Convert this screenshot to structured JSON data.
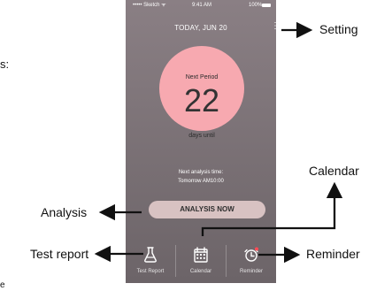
{
  "page_cutoff_text": {
    "left_top": "s:",
    "left_bottom": "e"
  },
  "status_bar": {
    "carrier": "••••• Sketch ᯤ",
    "time": "9:41 AM",
    "battery": "100%"
  },
  "header": {
    "title": "TODAY, JUN 20",
    "more_icon": "more-vertical-icon"
  },
  "period_card": {
    "label": "Next Period",
    "days": "22",
    "suffix": "days until"
  },
  "analysis_time": {
    "label": "Next analysis time:",
    "value": "Tomorrow AM10:00"
  },
  "analysis_button": {
    "label": "ANALYSIS NOW"
  },
  "bottom_nav": [
    {
      "label": "Test Report",
      "icon": "flask-icon"
    },
    {
      "label": "Calendar",
      "icon": "calendar-icon"
    },
    {
      "label": "Reminder",
      "icon": "alarm-clock-icon"
    }
  ],
  "annotations": {
    "setting": "Setting",
    "analysis": "Analysis",
    "test_report": "Test report",
    "calendar": "Calendar",
    "reminder": "Reminder"
  },
  "colors": {
    "phone_background": "#776e72",
    "period_circle": "#f7a9b0",
    "analysis_button": "#d8c2c2",
    "reminder_badge": "#ff4b55"
  }
}
